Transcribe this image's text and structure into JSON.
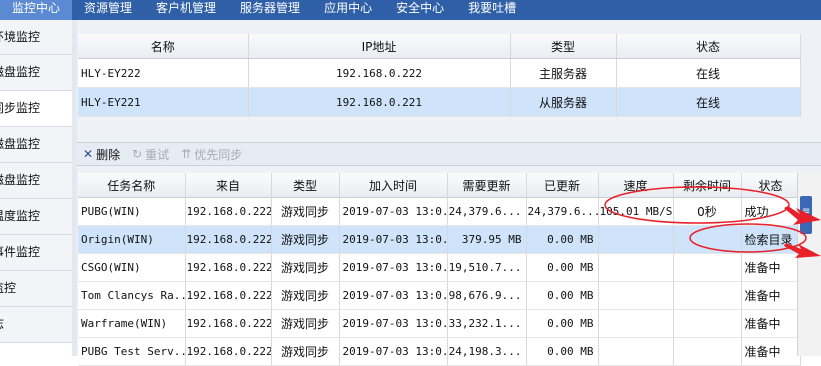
{
  "topnav": {
    "tabs": [
      {
        "label": "监控中心",
        "active": true
      },
      {
        "label": "资源管理"
      },
      {
        "label": "客户机管理"
      },
      {
        "label": "服务器管理"
      },
      {
        "label": "应用中心"
      },
      {
        "label": "安全中心"
      },
      {
        "label": "我要吐槽"
      }
    ]
  },
  "sidebar": {
    "items": [
      {
        "label": "环境监控"
      },
      {
        "label": "磁盘监控"
      },
      {
        "label": "同步监控",
        "active": true
      },
      {
        "label": "磁盘监控"
      },
      {
        "label": "磁盘监控"
      },
      {
        "label": "温度监控"
      },
      {
        "label": "事件监控"
      },
      {
        "label": "监控"
      },
      {
        "label": "志"
      }
    ]
  },
  "servers": {
    "headers": [
      "名称",
      "IP地址",
      "类型",
      "状态"
    ],
    "rows": [
      {
        "name": "HLY-EY222",
        "ip": "192.168.0.222",
        "type": "主服务器",
        "status": "在线"
      },
      {
        "name": "HLY-EY221",
        "ip": "192.168.0.221",
        "type": "从服务器",
        "status": "在线"
      }
    ]
  },
  "toolbar": {
    "delete_label": "删除",
    "retry_label": "重试",
    "priority_label": "优先同步"
  },
  "tasks": {
    "headers": [
      "任务名称",
      "来自",
      "类型",
      "加入时间",
      "需要更新",
      "已更新",
      "速度",
      "剩余时间",
      "状态"
    ],
    "rows": [
      {
        "name": "PUBG(WIN)",
        "from": "192.168.0.222",
        "type": "游戏同步",
        "time": "2019-07-03 13:0...",
        "need": "24,379.6...",
        "done": "24,379.6...",
        "speed": "105.01 MB/S",
        "remain": "0秒",
        "status": "成功"
      },
      {
        "name": "Origin(WIN)",
        "from": "192.168.0.222",
        "type": "游戏同步",
        "time": "2019-07-03 13:0...",
        "need": "379.95 MB",
        "done": "0.00 MB",
        "speed": "",
        "remain": "",
        "status": "检索目录"
      },
      {
        "name": "CSGO(WIN)",
        "from": "192.168.0.222",
        "type": "游戏同步",
        "time": "2019-07-03 13:0...",
        "need": "19,510.7...",
        "done": "0.00 MB",
        "speed": "",
        "remain": "",
        "status": "准备中"
      },
      {
        "name": "Tom Clancys Ra...",
        "from": "192.168.0.222",
        "type": "游戏同步",
        "time": "2019-07-03 13:0...",
        "need": "98,676.9...",
        "done": "0.00 MB",
        "speed": "",
        "remain": "",
        "status": "准备中"
      },
      {
        "name": "Warframe(WIN)",
        "from": "192.168.0.222",
        "type": "游戏同步",
        "time": "2019-07-03 13:0...",
        "need": "33,232.1...",
        "done": "0.00 MB",
        "speed": "",
        "remain": "",
        "status": "准备中"
      },
      {
        "name": "PUBG Test Serv...",
        "from": "192.168.0.222",
        "type": "游戏同步",
        "time": "2019-07-03 13:0...",
        "need": "24,198.3...",
        "done": "0.00 MB",
        "speed": "",
        "remain": "",
        "status": "准备中"
      }
    ]
  },
  "colors": {
    "nav_bg": "#2f5fa7",
    "nav_active": "#5b8ad3",
    "selection": "#cfe4fa",
    "annotation_red": "#e8202a"
  }
}
